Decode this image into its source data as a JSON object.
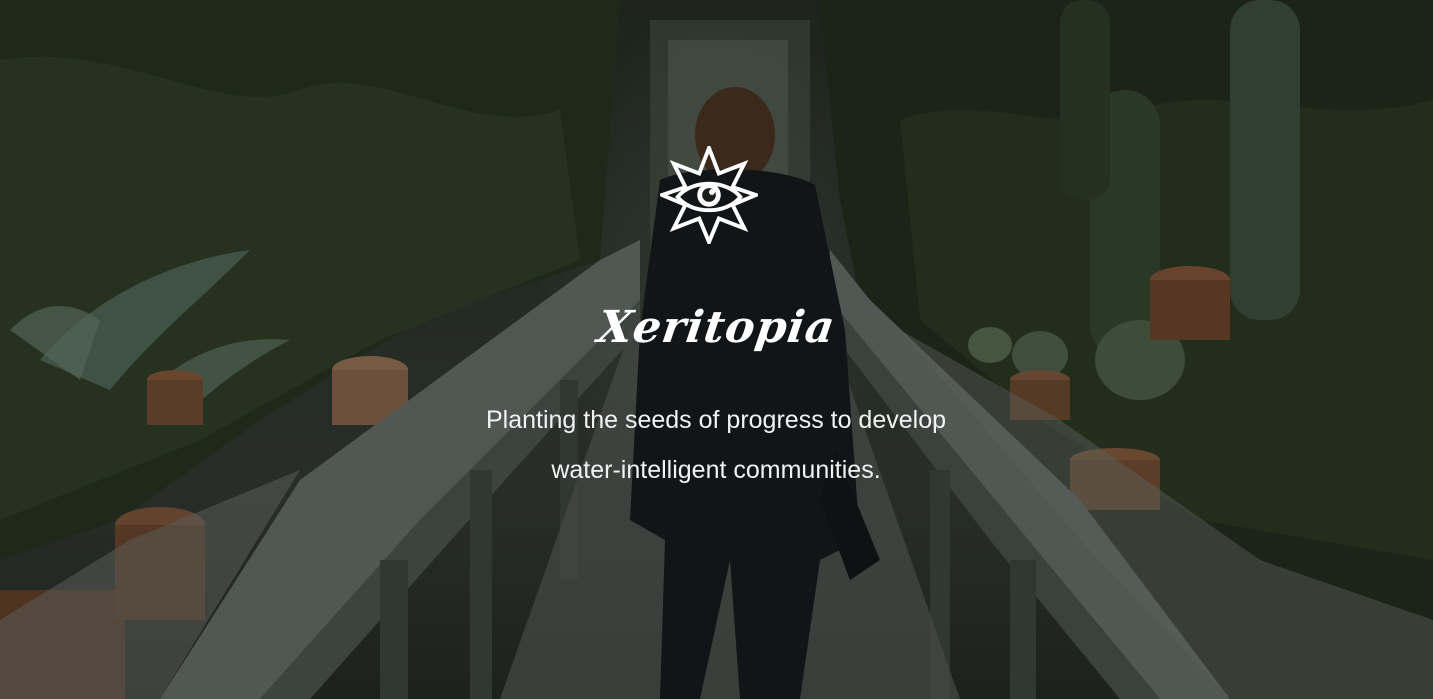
{
  "hero": {
    "brand_name": "Xeritopia",
    "tagline_line1": "Planting the seeds of progress to develop",
    "tagline_line2": "water-intelligent communities.",
    "logo_icon": "star-eye-icon",
    "background": "greenhouse-cactus-photo"
  },
  "colors": {
    "text": "#ffffff",
    "overlay": "#0a0e0a"
  }
}
